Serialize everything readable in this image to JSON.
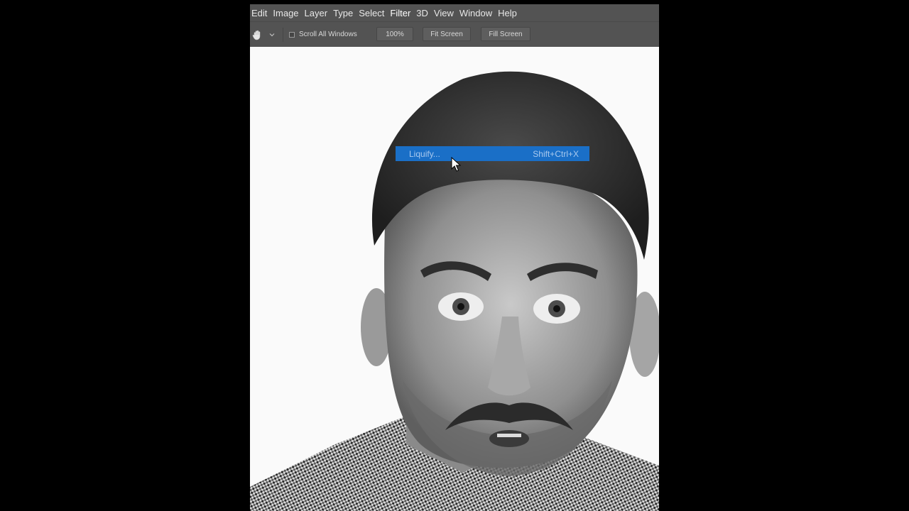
{
  "menubar": {
    "items": [
      "Edit",
      "Image",
      "Layer",
      "Type",
      "Select",
      "Filter",
      "3D",
      "View",
      "Window",
      "Help"
    ],
    "active_item": "Filter"
  },
  "options_bar": {
    "tool_icon": "hand-icon",
    "scroll_all_windows_label": "Scroll All Windows",
    "scroll_all_windows_checked": false,
    "zoom_button_label": "100%",
    "fit_screen_label": "Fit Screen",
    "fill_screen_label": "Fill Screen"
  },
  "filter_menu": {
    "highlighted_item": {
      "label": "Liquify...",
      "shortcut": "Shift+Ctrl+X"
    }
  },
  "canvas": {
    "image_description_icon": "portrait-photo",
    "background_color": "#fafafa"
  },
  "colors": {
    "menubar_bg": "#535353",
    "menu_highlight": "#1a6fc7"
  }
}
